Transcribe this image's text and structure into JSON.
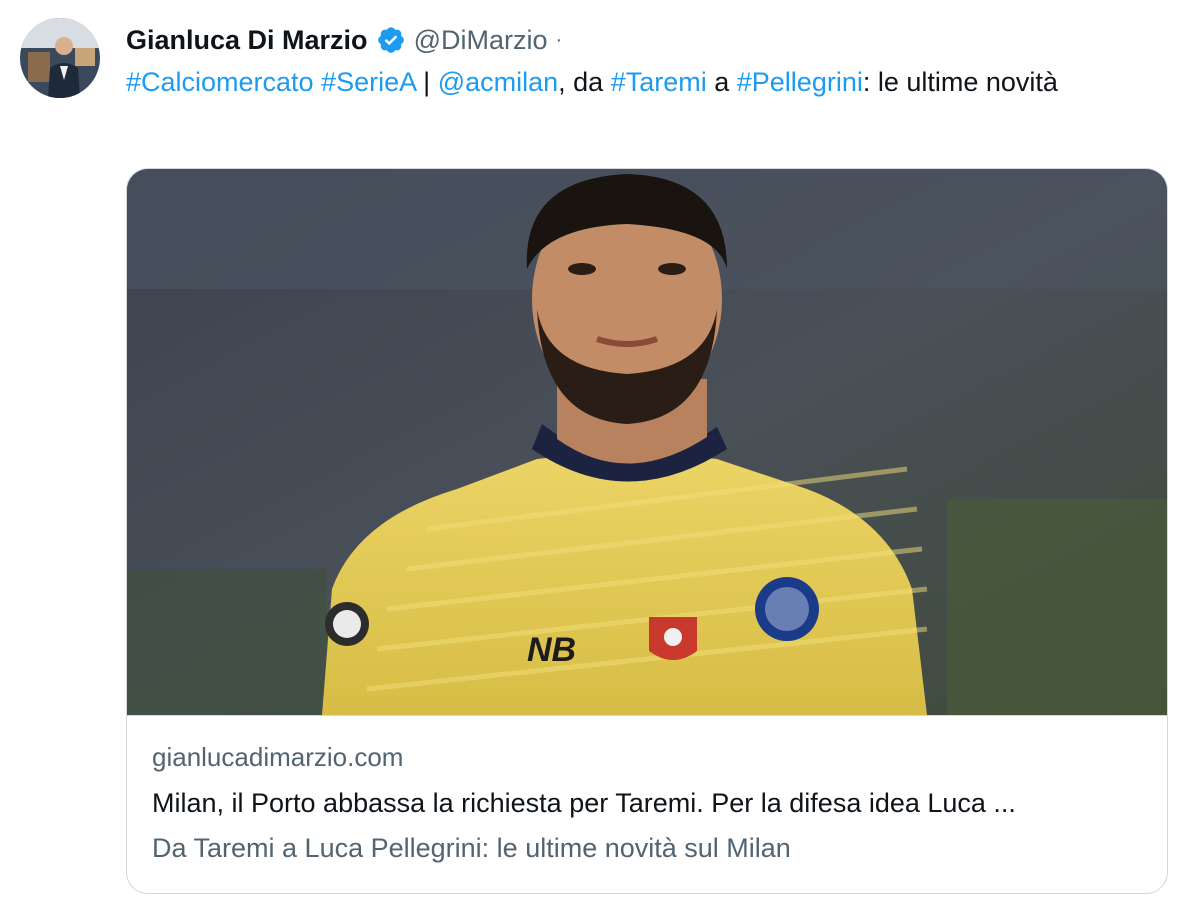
{
  "author": {
    "display_name": "Gianluca Di Marzio",
    "handle": "@DiMarzio",
    "separator": "·",
    "avatar_icon": "avatar-photo",
    "verified_icon": "verified-badge-icon"
  },
  "tweet": {
    "parts": [
      {
        "text": "#Calciomercato",
        "link": true
      },
      {
        "text": " ",
        "link": false
      },
      {
        "text": "#SerieA",
        "link": true
      },
      {
        "text": " | ",
        "link": false
      },
      {
        "text": "@acmilan",
        "link": true
      },
      {
        "text": ", da ",
        "link": false
      },
      {
        "text": "#Taremi",
        "link": true
      },
      {
        "text": " a ",
        "link": false
      },
      {
        "text": "#Pellegrini",
        "link": true
      },
      {
        "text": ": le ultime novità",
        "link": false
      }
    ]
  },
  "card": {
    "image_alt": "footballer-photo",
    "domain": "gianlucadimarzio.com",
    "title": "Milan, il Porto abbassa la richiesta per Taremi. Per la difesa idea Luca ...",
    "description": "Da Taremi a Luca Pellegrini: le ultime novità sul Milan"
  },
  "colors": {
    "link": "#1d9bf0",
    "secondary_text": "#536471",
    "primary_text": "#0f1419",
    "border": "#cfd9de",
    "verified": "#1d9bf0",
    "jersey": "#e8cf5a"
  }
}
